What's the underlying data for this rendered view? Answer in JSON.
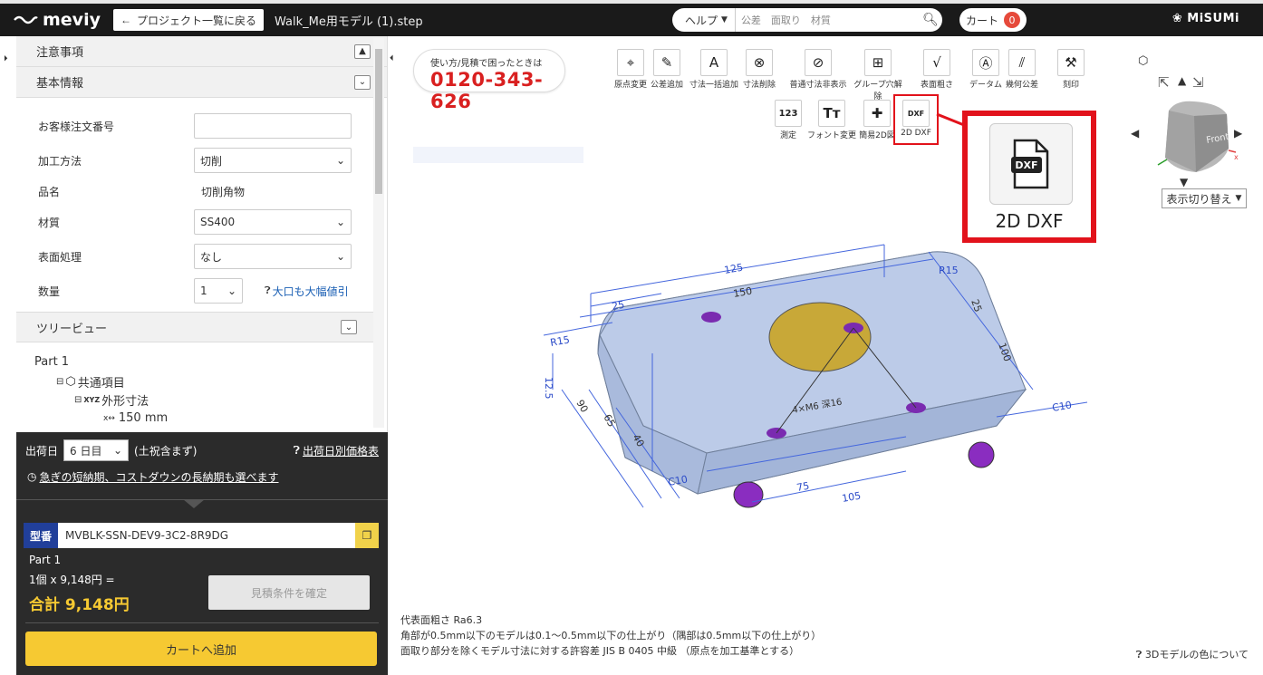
{
  "header": {
    "logo": "meviy",
    "back_label": "プロジェクト一覧に戻る",
    "filename": "Walk_Me用モデル (1).step",
    "help_label": "ヘルプ",
    "search_placeholder": "公差　面取り　材質",
    "cart_label": "カート",
    "cart_count": "0",
    "brand": "MiSUMi"
  },
  "sidebar": {
    "notes_title": "注意事項",
    "basic_title": "基本情報",
    "fields": {
      "order_label": "お客様注文番号",
      "order_value": "",
      "method_label": "加工方法",
      "method_value": "切削",
      "name_label": "品名",
      "name_value": "切削角物",
      "material_label": "材質",
      "material_value": "SS400",
      "surface_label": "表面処理",
      "surface_value": "なし",
      "qty_label": "数量",
      "qty_value": "1",
      "discount_link": "大口も大幅値引"
    },
    "tree_title": "ツリービュー",
    "tree": {
      "root": "Part 1",
      "common": "共通項目",
      "outer": "外形寸法",
      "dim": "150 mm"
    }
  },
  "order": {
    "ship_label": "出荷日",
    "ship_value": "6 日目",
    "ship_note": "(土祝含まず)",
    "price_table_link": "出荷日別価格表",
    "express_link": "急ぎの短納期、コストダウンの長納期も選べます",
    "part_no_badge": "型番",
    "part_no": "MVBLK-SSN-DEV9-3C2-8R9DG",
    "part_name": "Part 1",
    "unit_price": "1個 x 9,148円 =",
    "total": "合計 9,148円",
    "confirm_label": "見積条件を確定",
    "addcart_label": "カートへ追加"
  },
  "viewport": {
    "phone_caption": "使い方/見積で困ったときは",
    "phone_number": "0120-343-626",
    "tools_row1": [
      "原点変更",
      "公差追加",
      "寸法一括追加",
      "寸法削除",
      "普通寸法非表示",
      "グループ穴解除",
      "表面粗さ",
      "データム",
      "幾何公差",
      "刻印"
    ],
    "tools_row2": [
      "測定",
      "フォント変更",
      "簡易2D図",
      "2D DXF"
    ],
    "callout_label": "2D DXF",
    "display_toggle": "表示切り替え",
    "cube_face": "Front",
    "notes": [
      "代表面粗さ Ra6.3",
      "角部が0.5mm以下のモデルは0.1〜0.5mm以下の仕上がり（隅部は0.5mm以下の仕上がり）",
      "面取り部分を除くモデル寸法に対する許容差 JIS B 0405 中級 （原点を加工基準とする）"
    ],
    "color_help": "3Dモデルの色について",
    "dimensions": [
      "125",
      "150",
      "25",
      "R15",
      "12.5",
      "25",
      "100",
      "R15",
      "C10",
      "4×M6 深16",
      "75",
      "105",
      "C10",
      "90",
      "65",
      "40"
    ]
  },
  "colors": {
    "accent_red": "#e2121b",
    "total_yellow": "#f6c932",
    "model_blue": "#b4c4e4",
    "hole_purple": "#7a2bb0",
    "bore_gold": "#c8a838"
  }
}
